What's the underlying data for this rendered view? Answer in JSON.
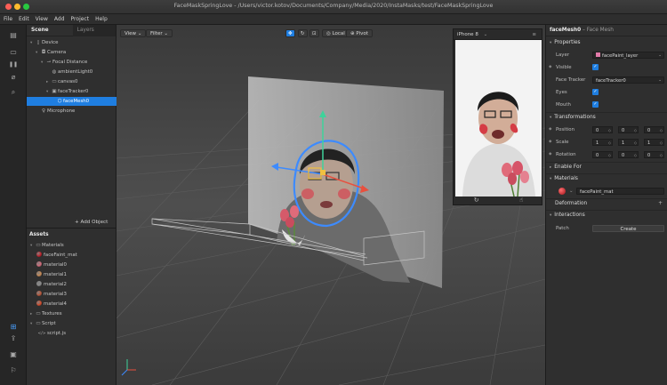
{
  "window": {
    "title": "FaceMaskSpringLove - /Users/victor.kotov/Documents/Company/Media/2020/InstaMasks/test/FaceMaskSpringLove",
    "traffic_colors": [
      "#fe5f57",
      "#febc2e",
      "#28c840"
    ]
  },
  "menu": [
    "File",
    "Edit",
    "View",
    "Add",
    "Project",
    "Help"
  ],
  "tools": [
    {
      "icon": "scene-panel-icon",
      "glyph": "▤"
    },
    {
      "icon": "video-icon",
      "glyph": "▭"
    },
    {
      "icon": "pause-icon",
      "glyph": "❚❚"
    },
    {
      "icon": "patch-icon",
      "glyph": "⌀"
    },
    {
      "icon": "search-icon",
      "glyph": "⌕"
    },
    {
      "icon": "add-device-icon",
      "glyph": "⊞"
    },
    {
      "icon": "share-icon",
      "glyph": "⇪"
    },
    {
      "icon": "library-icon",
      "glyph": "▣"
    },
    {
      "icon": "feedback-icon",
      "glyph": "⚐"
    }
  ],
  "scene": {
    "tab_label": "Scene",
    "layers_tab": "Layers",
    "tree": [
      {
        "label": "Device",
        "depth": 0,
        "icon": "device-icon",
        "glyph": "▯",
        "twisty": "▾"
      },
      {
        "label": "Camera",
        "depth": 1,
        "icon": "camera-icon",
        "glyph": "◘",
        "twisty": "▾"
      },
      {
        "label": "Focal Distance",
        "depth": 2,
        "icon": "focal-distance-icon",
        "glyph": "⊸",
        "twisty": "▾"
      },
      {
        "label": "ambientLight0",
        "depth": 3,
        "icon": "light-icon",
        "glyph": "◍",
        "twisty": ""
      },
      {
        "label": "canvas0",
        "depth": 3,
        "icon": "canvas-icon",
        "glyph": "▭",
        "twisty": "▸"
      },
      {
        "label": "faceTracker0",
        "depth": 3,
        "icon": "face-tracker-icon",
        "glyph": "▣",
        "twisty": "▾"
      },
      {
        "label": "faceMesh0",
        "depth": 4,
        "icon": "face-mesh-icon",
        "glyph": "⬡",
        "twisty": "",
        "selected": true
      },
      {
        "label": "Microphone",
        "depth": 1,
        "icon": "microphone-icon",
        "glyph": "♀",
        "twisty": ""
      }
    ],
    "add_object": "+ Add Object"
  },
  "assets": {
    "title": "Assets",
    "tree": [
      {
        "label": "Materials",
        "depth": 0,
        "icon": "folder-icon",
        "glyph": "▭",
        "twisty": "▾"
      },
      {
        "label": "faceFaint_mat",
        "depth": 1,
        "icon": "material-sphere-icon",
        "color": "#c0202a"
      },
      {
        "label": "material0",
        "depth": 1,
        "icon": "material-sphere-icon",
        "color": "#d36a7a"
      },
      {
        "label": "material1",
        "depth": 1,
        "icon": "material-sphere-icon",
        "color": "#c88a55"
      },
      {
        "label": "material2",
        "depth": 1,
        "icon": "material-sphere-icon",
        "color": "#8a8a8a"
      },
      {
        "label": "material3",
        "depth": 1,
        "icon": "material-sphere-icon",
        "color": "#b8563a"
      },
      {
        "label": "material4",
        "depth": 1,
        "icon": "material-sphere-icon",
        "color": "#d24b2b"
      },
      {
        "label": "Textures",
        "depth": 0,
        "icon": "folder-icon",
        "glyph": "▭",
        "twisty": "▸"
      },
      {
        "label": "Script",
        "depth": 0,
        "icon": "folder-icon",
        "glyph": "▭",
        "twisty": "▾"
      },
      {
        "label": "script.js",
        "depth": 1,
        "icon": "script-icon",
        "glyph": "</>"
      }
    ]
  },
  "viewport": {
    "view_label": "View",
    "filter_label": "Filter",
    "local_label": "Local",
    "pivot_label": "Pivot"
  },
  "simulator": {
    "device": "iPhone 8"
  },
  "inspector": {
    "object_name": "faceMesh0",
    "object_type": "– Face Mesh",
    "sections": {
      "properties": "Properties",
      "transformations": "Transformations",
      "enable_for": "Enable For",
      "materials": "Materials",
      "deformation": "Deformation",
      "interactions": "Interactions"
    },
    "layer": {
      "label": "Layer",
      "value": "facePaint_layer",
      "swatch": "#e07aa8"
    },
    "visible": {
      "label": "Visible",
      "checked": true
    },
    "face_tracker": {
      "label": "Face Tracker",
      "value": "faceTracker0"
    },
    "eyes": {
      "label": "Eyes",
      "checked": true
    },
    "mouth": {
      "label": "Mouth",
      "checked": true
    },
    "position": {
      "label": "Position",
      "x": "0",
      "y": "0",
      "z": "0"
    },
    "scale": {
      "label": "Scale",
      "x": "1",
      "y": "1",
      "z": "1"
    },
    "rotation": {
      "label": "Rotation",
      "x": "0",
      "y": "0",
      "z": "0"
    },
    "material_value": "facePaint_mat",
    "patch_label": "Patch",
    "create_label": "Create"
  }
}
